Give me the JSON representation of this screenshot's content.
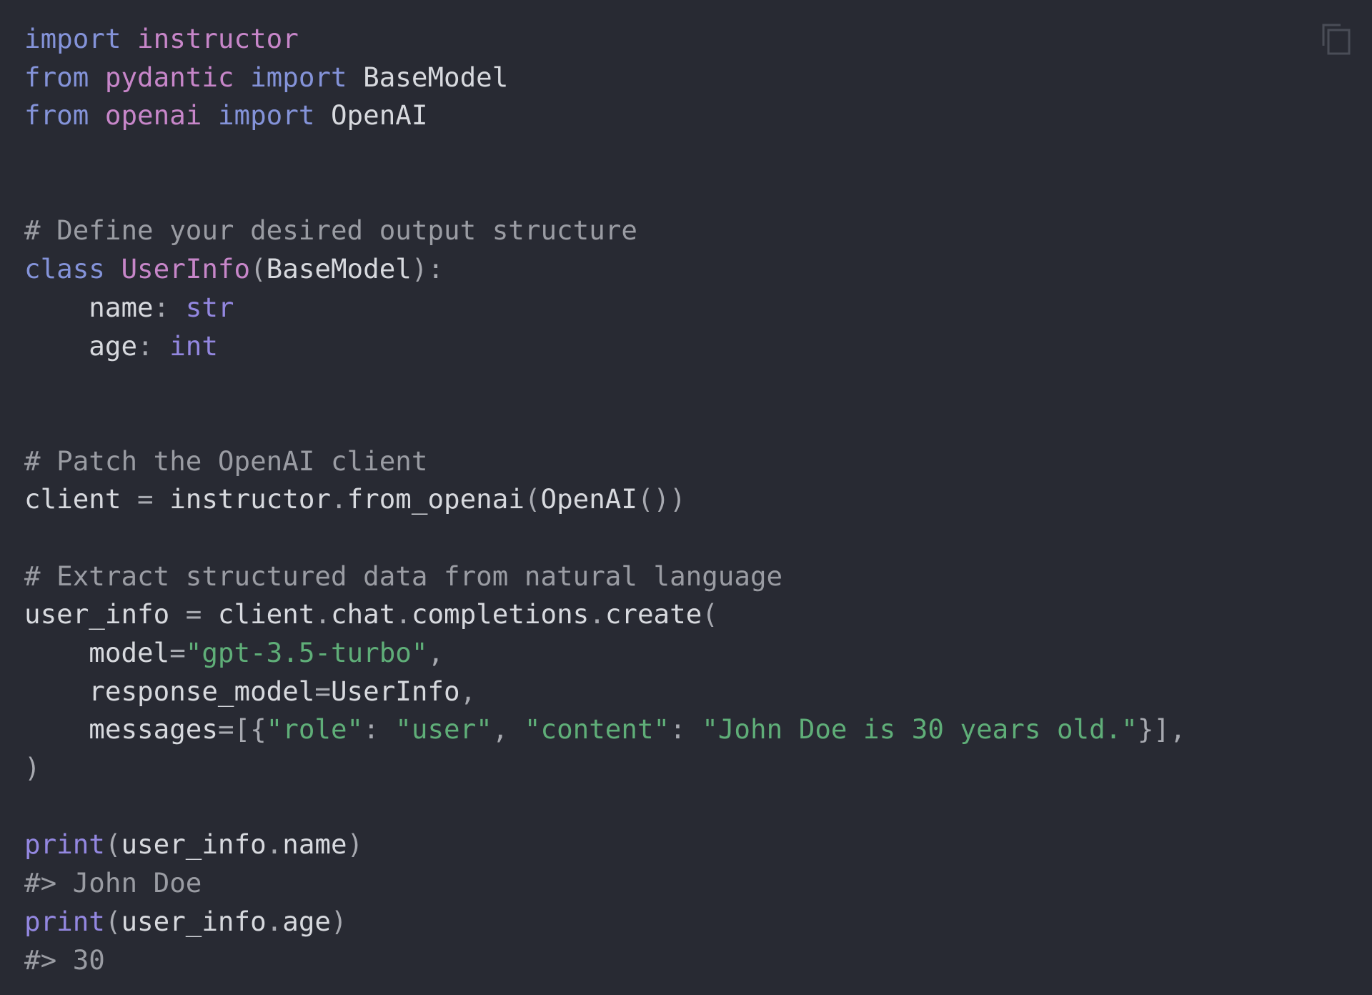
{
  "code_block": {
    "language": "python",
    "copy_button_label": "Copy",
    "copy_icon": "copy-icon",
    "colors": {
      "background": "#282a33",
      "keyword": "#8493d9",
      "module": "#c786c9",
      "builtin": "#9387e0",
      "string": "#5fae78",
      "comment": "#9a9ca3",
      "text": "#d7d9de"
    },
    "lines": [
      [
        {
          "t": "import",
          "k": "kw"
        },
        {
          "t": " "
        },
        {
          "t": "instructor",
          "k": "mod"
        }
      ],
      [
        {
          "t": "from",
          "k": "kw"
        },
        {
          "t": " "
        },
        {
          "t": "pydantic",
          "k": "mod"
        },
        {
          "t": " "
        },
        {
          "t": "import",
          "k": "kw"
        },
        {
          "t": " BaseModel",
          "k": "id"
        }
      ],
      [
        {
          "t": "from",
          "k": "kw"
        },
        {
          "t": " "
        },
        {
          "t": "openai",
          "k": "mod"
        },
        {
          "t": " "
        },
        {
          "t": "import",
          "k": "kw"
        },
        {
          "t": " OpenAI",
          "k": "id"
        }
      ],
      [],
      [],
      [
        {
          "t": "# Define your desired output structure",
          "k": "cm"
        }
      ],
      [
        {
          "t": "class",
          "k": "kw"
        },
        {
          "t": " "
        },
        {
          "t": "UserInfo",
          "k": "cls"
        },
        {
          "t": "(",
          "k": "pn"
        },
        {
          "t": "BaseModel",
          "k": "id"
        },
        {
          "t": "):",
          "k": "pn"
        }
      ],
      [
        {
          "t": "    name",
          "k": "id"
        },
        {
          "t": ": ",
          "k": "pn"
        },
        {
          "t": "str",
          "k": "bi"
        }
      ],
      [
        {
          "t": "    age",
          "k": "id"
        },
        {
          "t": ": ",
          "k": "pn"
        },
        {
          "t": "int",
          "k": "bi"
        }
      ],
      [],
      [],
      [
        {
          "t": "# Patch the OpenAI client",
          "k": "cm"
        }
      ],
      [
        {
          "t": "client ",
          "k": "id"
        },
        {
          "t": "=",
          "k": "pn"
        },
        {
          "t": " instructor",
          "k": "id"
        },
        {
          "t": ".",
          "k": "pn"
        },
        {
          "t": "from_openai",
          "k": "id"
        },
        {
          "t": "(",
          "k": "pn"
        },
        {
          "t": "OpenAI",
          "k": "id"
        },
        {
          "t": "())",
          "k": "pn"
        }
      ],
      [],
      [
        {
          "t": "# Extract structured data from natural language",
          "k": "cm"
        }
      ],
      [
        {
          "t": "user_info ",
          "k": "id"
        },
        {
          "t": "=",
          "k": "pn"
        },
        {
          "t": " client",
          "k": "id"
        },
        {
          "t": ".",
          "k": "pn"
        },
        {
          "t": "chat",
          "k": "id"
        },
        {
          "t": ".",
          "k": "pn"
        },
        {
          "t": "completions",
          "k": "id"
        },
        {
          "t": ".",
          "k": "pn"
        },
        {
          "t": "create",
          "k": "id"
        },
        {
          "t": "(",
          "k": "pn"
        }
      ],
      [
        {
          "t": "    model",
          "k": "id"
        },
        {
          "t": "=",
          "k": "pn"
        },
        {
          "t": "\"gpt-3.5-turbo\"",
          "k": "str"
        },
        {
          "t": ",",
          "k": "pn"
        }
      ],
      [
        {
          "t": "    response_model",
          "k": "id"
        },
        {
          "t": "=",
          "k": "pn"
        },
        {
          "t": "UserInfo",
          "k": "id"
        },
        {
          "t": ",",
          "k": "pn"
        }
      ],
      [
        {
          "t": "    messages",
          "k": "id"
        },
        {
          "t": "=[{",
          "k": "pn"
        },
        {
          "t": "\"role\"",
          "k": "str"
        },
        {
          "t": ": ",
          "k": "pn"
        },
        {
          "t": "\"user\"",
          "k": "str"
        },
        {
          "t": ", ",
          "k": "pn"
        },
        {
          "t": "\"content\"",
          "k": "str"
        },
        {
          "t": ": ",
          "k": "pn"
        },
        {
          "t": "\"John Doe is 30 years old.\"",
          "k": "str"
        },
        {
          "t": "}],",
          "k": "pn"
        }
      ],
      [
        {
          "t": ")",
          "k": "pn"
        }
      ],
      [],
      [
        {
          "t": "print",
          "k": "bi"
        },
        {
          "t": "(",
          "k": "pn"
        },
        {
          "t": "user_info",
          "k": "id"
        },
        {
          "t": ".",
          "k": "pn"
        },
        {
          "t": "name",
          "k": "id"
        },
        {
          "t": ")",
          "k": "pn"
        }
      ],
      [
        {
          "t": "#> John Doe",
          "k": "cm"
        }
      ],
      [
        {
          "t": "print",
          "k": "bi"
        },
        {
          "t": "(",
          "k": "pn"
        },
        {
          "t": "user_info",
          "k": "id"
        },
        {
          "t": ".",
          "k": "pn"
        },
        {
          "t": "age",
          "k": "id"
        },
        {
          "t": ")",
          "k": "pn"
        }
      ],
      [
        {
          "t": "#> 30",
          "k": "cm"
        }
      ]
    ]
  }
}
